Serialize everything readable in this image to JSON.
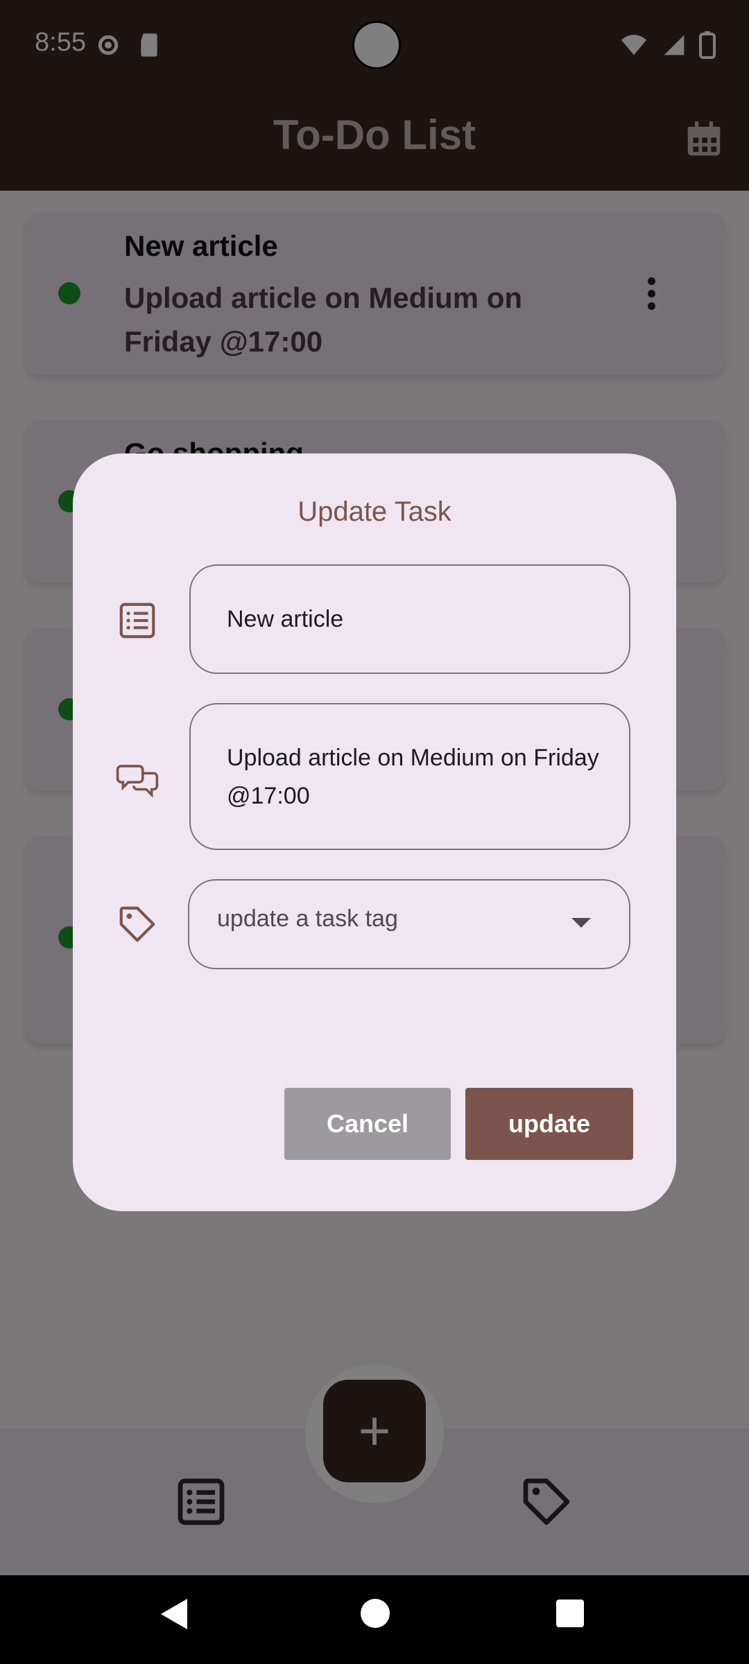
{
  "status_bar": {
    "time": "8:55"
  },
  "app": {
    "title": "To-Do List"
  },
  "tasks": [
    {
      "title": "New article",
      "description": "Upload article on Medium on Friday @17:00"
    },
    {
      "title": "Go shopping",
      "description": ""
    },
    {
      "title": "",
      "description": ""
    },
    {
      "title": "",
      "description": ""
    }
  ],
  "dialog": {
    "title": "Update Task",
    "title_field_value": "New article",
    "description_field_value": "Upload article on Medium on Friday @17:00",
    "tag_dropdown_placeholder": "update a task tag",
    "cancel_label": "Cancel",
    "update_label": "update"
  },
  "fab": {
    "label": "+"
  },
  "colors": {
    "primary_dark": "#3a2621",
    "accent_brown": "#7b554d",
    "dialog_bg": "#efe6f2",
    "card_bg": "#ece2ee",
    "status_green": "#1f9a2d"
  }
}
